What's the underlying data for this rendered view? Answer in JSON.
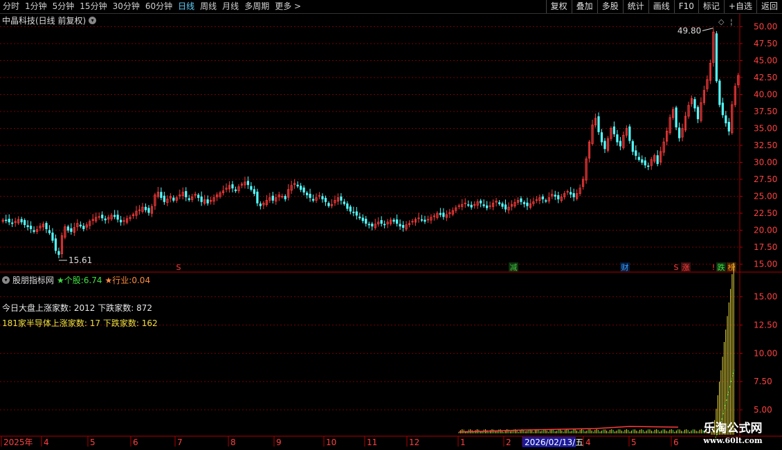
{
  "toolbar": {
    "tabs": [
      {
        "label": "分时"
      },
      {
        "label": "1分钟"
      },
      {
        "label": "5分钟"
      },
      {
        "label": "15分钟"
      },
      {
        "label": "30分钟"
      },
      {
        "label": "60分钟"
      },
      {
        "label": "日线"
      },
      {
        "label": "周线"
      },
      {
        "label": "月线"
      },
      {
        "label": "多周期"
      },
      {
        "label": "更多 >"
      }
    ],
    "active_tab": "日线",
    "right_buttons": [
      {
        "label": "复权"
      },
      {
        "label": "叠加"
      },
      {
        "label": "多股"
      },
      {
        "label": "统计"
      },
      {
        "label": "画线"
      },
      {
        "label": "F10"
      },
      {
        "label": "标记"
      },
      {
        "label": "+自选"
      },
      {
        "label": "返回"
      }
    ]
  },
  "main_chart": {
    "title": "中晶科技(日线 前复权)",
    "high_label": "49.80",
    "low_label": "15.61",
    "markers": [
      "S",
      "减",
      "财",
      "S",
      "涨",
      "!",
      "跌",
      "榜"
    ]
  },
  "indicator": {
    "name": "股朋指标网",
    "stock_label": "★个股:",
    "stock_value": "6.74",
    "industry_label": "★行业:",
    "industry_value": "0.04",
    "line1": "今日大盘上涨家数: 2012 下跌家数: 872",
    "line2": "181家半导体上涨家数: 17 下跌家数: 162"
  },
  "x_axis": {
    "labels": [
      "2025年",
      "4",
      "5",
      "6",
      "7",
      "8",
      "9",
      "10",
      "11",
      "12",
      "1",
      "2",
      "2026/02/13/五",
      "4",
      "5",
      "6"
    ]
  },
  "watermark": {
    "line1": "乐淘公式网",
    "line2": "www.60lt.com"
  },
  "colors": {
    "up": "#ff3c3c",
    "down": "#54ffff",
    "grid": "#7a0000",
    "axis": "#b00000",
    "active_tab": "#5fd3ff",
    "yellow": "#f0e040",
    "green": "#40e040"
  },
  "chart_data": [
    {
      "type": "candlestick",
      "title": "中晶科技(日线 前复权)",
      "y_ticks": [
        15.0,
        17.5,
        20.0,
        22.5,
        25.0,
        27.5,
        30.0,
        32.5,
        35.0,
        37.5,
        40.0,
        42.5,
        45.0,
        47.5,
        50.0
      ],
      "ylim": [
        15.0,
        50.0
      ],
      "annotations": {
        "high": 49.8,
        "low": 15.61
      },
      "close_path": [
        21.5,
        21.4,
        21.2,
        21.0,
        21.3,
        21.6,
        21.2,
        20.8,
        20.5,
        20.2,
        19.8,
        20.1,
        20.6,
        20.9,
        20.2,
        19.6,
        18.5,
        17.0,
        16.4,
        19.2,
        20.5,
        20.0,
        19.8,
        20.4,
        21.0,
        20.6,
        20.2,
        20.8,
        21.3,
        21.6,
        21.9,
        22.0,
        21.8,
        21.5,
        21.9,
        22.2,
        22.0,
        21.6,
        21.2,
        21.4,
        21.7,
        21.9,
        22.3,
        22.8,
        23.0,
        23.4,
        23.0,
        22.6,
        23.5,
        25.2,
        25.6,
        24.8,
        24.2,
        24.6,
        25.0,
        24.4,
        24.8,
        25.2,
        25.6,
        24.9,
        24.5,
        24.9,
        25.3,
        24.8,
        24.2,
        24.5,
        24.0,
        24.4,
        24.8,
        25.2,
        25.5,
        25.8,
        26.2,
        26.6,
        26.2,
        25.8,
        26.4,
        26.8,
        27.1,
        26.7,
        26.0,
        25.4,
        24.0,
        23.6,
        24.0,
        24.4,
        24.8,
        24.4,
        24.8,
        25.2,
        25.0,
        24.6,
        26.0,
        26.6,
        26.9,
        26.5,
        26.0,
        25.6,
        25.2,
        24.8,
        24.4,
        24.8,
        25.1,
        24.6,
        24.2,
        23.6,
        23.8,
        24.4,
        24.8,
        24.4,
        23.9,
        23.2,
        22.8,
        22.6,
        22.2,
        21.8,
        21.4,
        21.0,
        20.8,
        20.6,
        20.9,
        21.2,
        21.0,
        20.8,
        21.2,
        21.5,
        21.3,
        21.0,
        20.6,
        20.4,
        20.8,
        21.0,
        21.3,
        21.6,
        21.8,
        21.5,
        21.3,
        21.6,
        21.9,
        22.1,
        22.5,
        22.3,
        22.0,
        22.3,
        22.6,
        22.9,
        23.3,
        23.6,
        23.8,
        24.0,
        23.7,
        23.4,
        23.8,
        24.2,
        24.0,
        23.6,
        23.3,
        23.6,
        24.0,
        24.3,
        23.9,
        23.5,
        23.1,
        23.4,
        23.8,
        24.1,
        24.4,
        24.2,
        23.9,
        23.6,
        23.9,
        24.2,
        24.5,
        24.8,
        24.6,
        24.3,
        24.8,
        25.3,
        25.0,
        24.6,
        24.9,
        25.4,
        25.7,
        25.3,
        24.9,
        25.4,
        26.2,
        27.5,
        30.5,
        33.0,
        35.5,
        36.5,
        34.5,
        33.0,
        32.0,
        33.5,
        35.0,
        34.2,
        33.0,
        32.4,
        34.0,
        35.0,
        33.2,
        31.6,
        31.0,
        30.4,
        30.0,
        29.6,
        29.4,
        30.4,
        31.0,
        29.8,
        31.6,
        33.0,
        34.6,
        36.6,
        37.8,
        35.2,
        33.6,
        35.0,
        36.8,
        38.4,
        39.4,
        38.0,
        36.4,
        38.8,
        40.6,
        42.2,
        44.6,
        49.2,
        42.0,
        38.5,
        37.0,
        35.8,
        34.6,
        38.5,
        41.2,
        42.8
      ],
      "bar_count": 248,
      "top_markers": [
        {
          "index": 240,
          "value": 49.8
        }
      ]
    },
    {
      "type": "bar",
      "title": "股朋指标网",
      "y_ticks": [
        5.0,
        7.5,
        10.0,
        12.5,
        15.0
      ],
      "ylim": [
        2.8,
        17.0
      ],
      "stock_value": 6.74,
      "industry_value": 0.04,
      "values": [
        1.6,
        2.0,
        2.6,
        3.6,
        4.8,
        6.0,
        7.0,
        8.2,
        9.5,
        10.6,
        11.8,
        13.0,
        14.2,
        15.5,
        16.5
      ],
      "green_line": [
        0.5,
        0.9,
        1.4,
        2.0,
        2.8,
        3.6,
        4.4,
        5.2,
        6.0,
        6.74
      ]
    }
  ]
}
